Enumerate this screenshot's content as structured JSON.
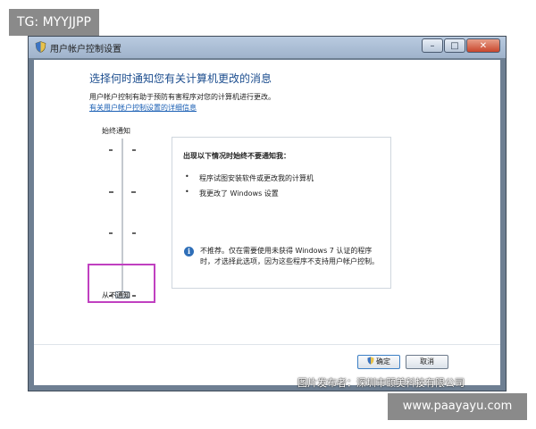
{
  "overlay": {
    "top_tag": "TG: MYYJJPP",
    "watermark": "图片发布者：深圳市颐美科技有限公司",
    "bottom_tag": "www.paayayu.com"
  },
  "window": {
    "title": "用户帐户控制设置",
    "minimize_glyph": "–",
    "maximize_glyph": "□",
    "close_glyph": "✕"
  },
  "content": {
    "heading": "选择何时通知您有关计算机更改的消息",
    "description": "用户帐户控制有助于预防有害程序对您的计算机进行更改。",
    "link": "有关用户帐户控制设置的详细信息"
  },
  "slider": {
    "top_label": "始终通知",
    "bottom_label": "从不通知",
    "position": 1,
    "levels": 4
  },
  "panel": {
    "title": "出现以下情况时始终不要通知我：",
    "bullet_glyph": "•",
    "items": [
      "程序试图安装软件或更改我的计算机",
      "我更改了 Windows 设置"
    ],
    "info_glyph": "i",
    "info_text": "不推荐。仅在需要使用未获得 Windows 7 认证的程序时，才选择此选项，因为这些程序不支持用户帐户控制。"
  },
  "buttons": {
    "ok": "确定",
    "cancel": "取消"
  },
  "colors": {
    "heading": "#1d4e8f",
    "link": "#1a5fb4",
    "highlight_box": "#c040c0"
  },
  "icons": {
    "window_icon": "uac-shield-icon",
    "ok_icon": "uac-shield-icon",
    "info_icon": "info-icon"
  }
}
